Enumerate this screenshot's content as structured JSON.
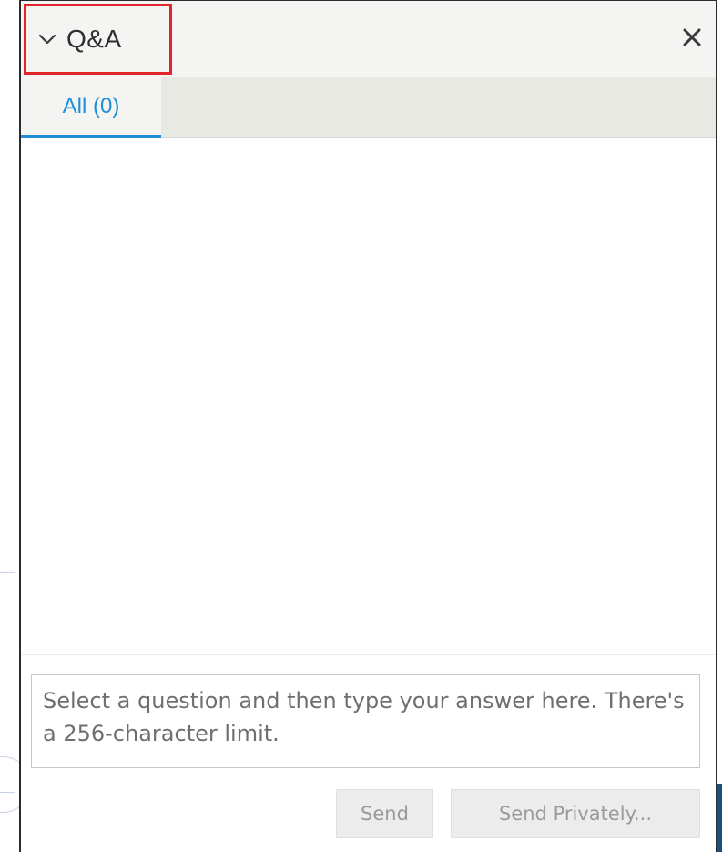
{
  "panel": {
    "title": "Q&A",
    "collapse_icon": "chevron-down-icon",
    "close_icon": "close-icon",
    "close_glyph": "✕"
  },
  "tabs": [
    {
      "label": "All (0)",
      "active": true
    }
  ],
  "answer_box": {
    "placeholder": "Select a question and then type your answer here. There's a 256-character limit.",
    "value": ""
  },
  "actions": {
    "send_label": "Send",
    "send_privately_label": "Send Privately..."
  },
  "colors": {
    "accent": "#1e8fd6",
    "highlight_border": "#e0252b",
    "header_bg": "#f4f4f2",
    "tabs_bg": "#e9e9e4",
    "disabled_button_bg": "#ececec",
    "disabled_button_text": "#9a9a9a"
  }
}
